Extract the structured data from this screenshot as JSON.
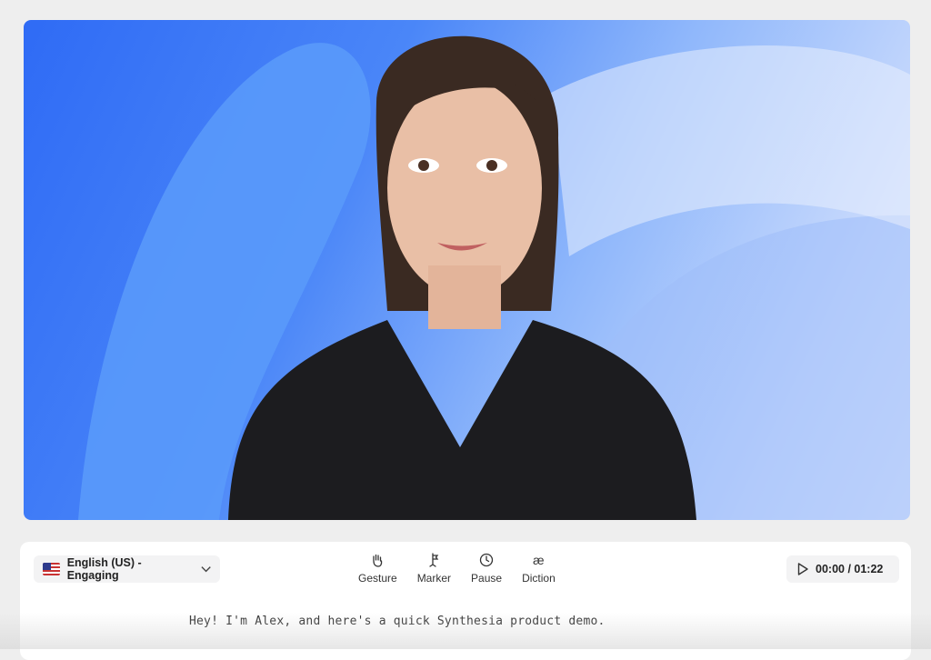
{
  "voice": {
    "flag_icon": "us-flag-icon",
    "label": "English (US) - Engaging",
    "chevron_icon": "chevron-down-icon"
  },
  "tools": [
    {
      "name": "gesture",
      "icon": "hand-wave-icon",
      "label": "Gesture"
    },
    {
      "name": "marker",
      "icon": "marker-icon",
      "label": "Marker"
    },
    {
      "name": "pause",
      "icon": "clock-icon",
      "label": "Pause"
    },
    {
      "name": "diction",
      "icon": "ae-glyph-icon",
      "label": "Diction"
    }
  ],
  "player": {
    "icon": "play-icon",
    "time": "00:00 / 01:22"
  },
  "script": {
    "text": "Hey! I'm Alex, and here's a quick Synthesia product demo."
  },
  "colors": {
    "stage_blue": "#2f6bf5",
    "stage_light": "#dfe8fd",
    "panel": "#ffffff",
    "chip": "#f3f3f4"
  }
}
